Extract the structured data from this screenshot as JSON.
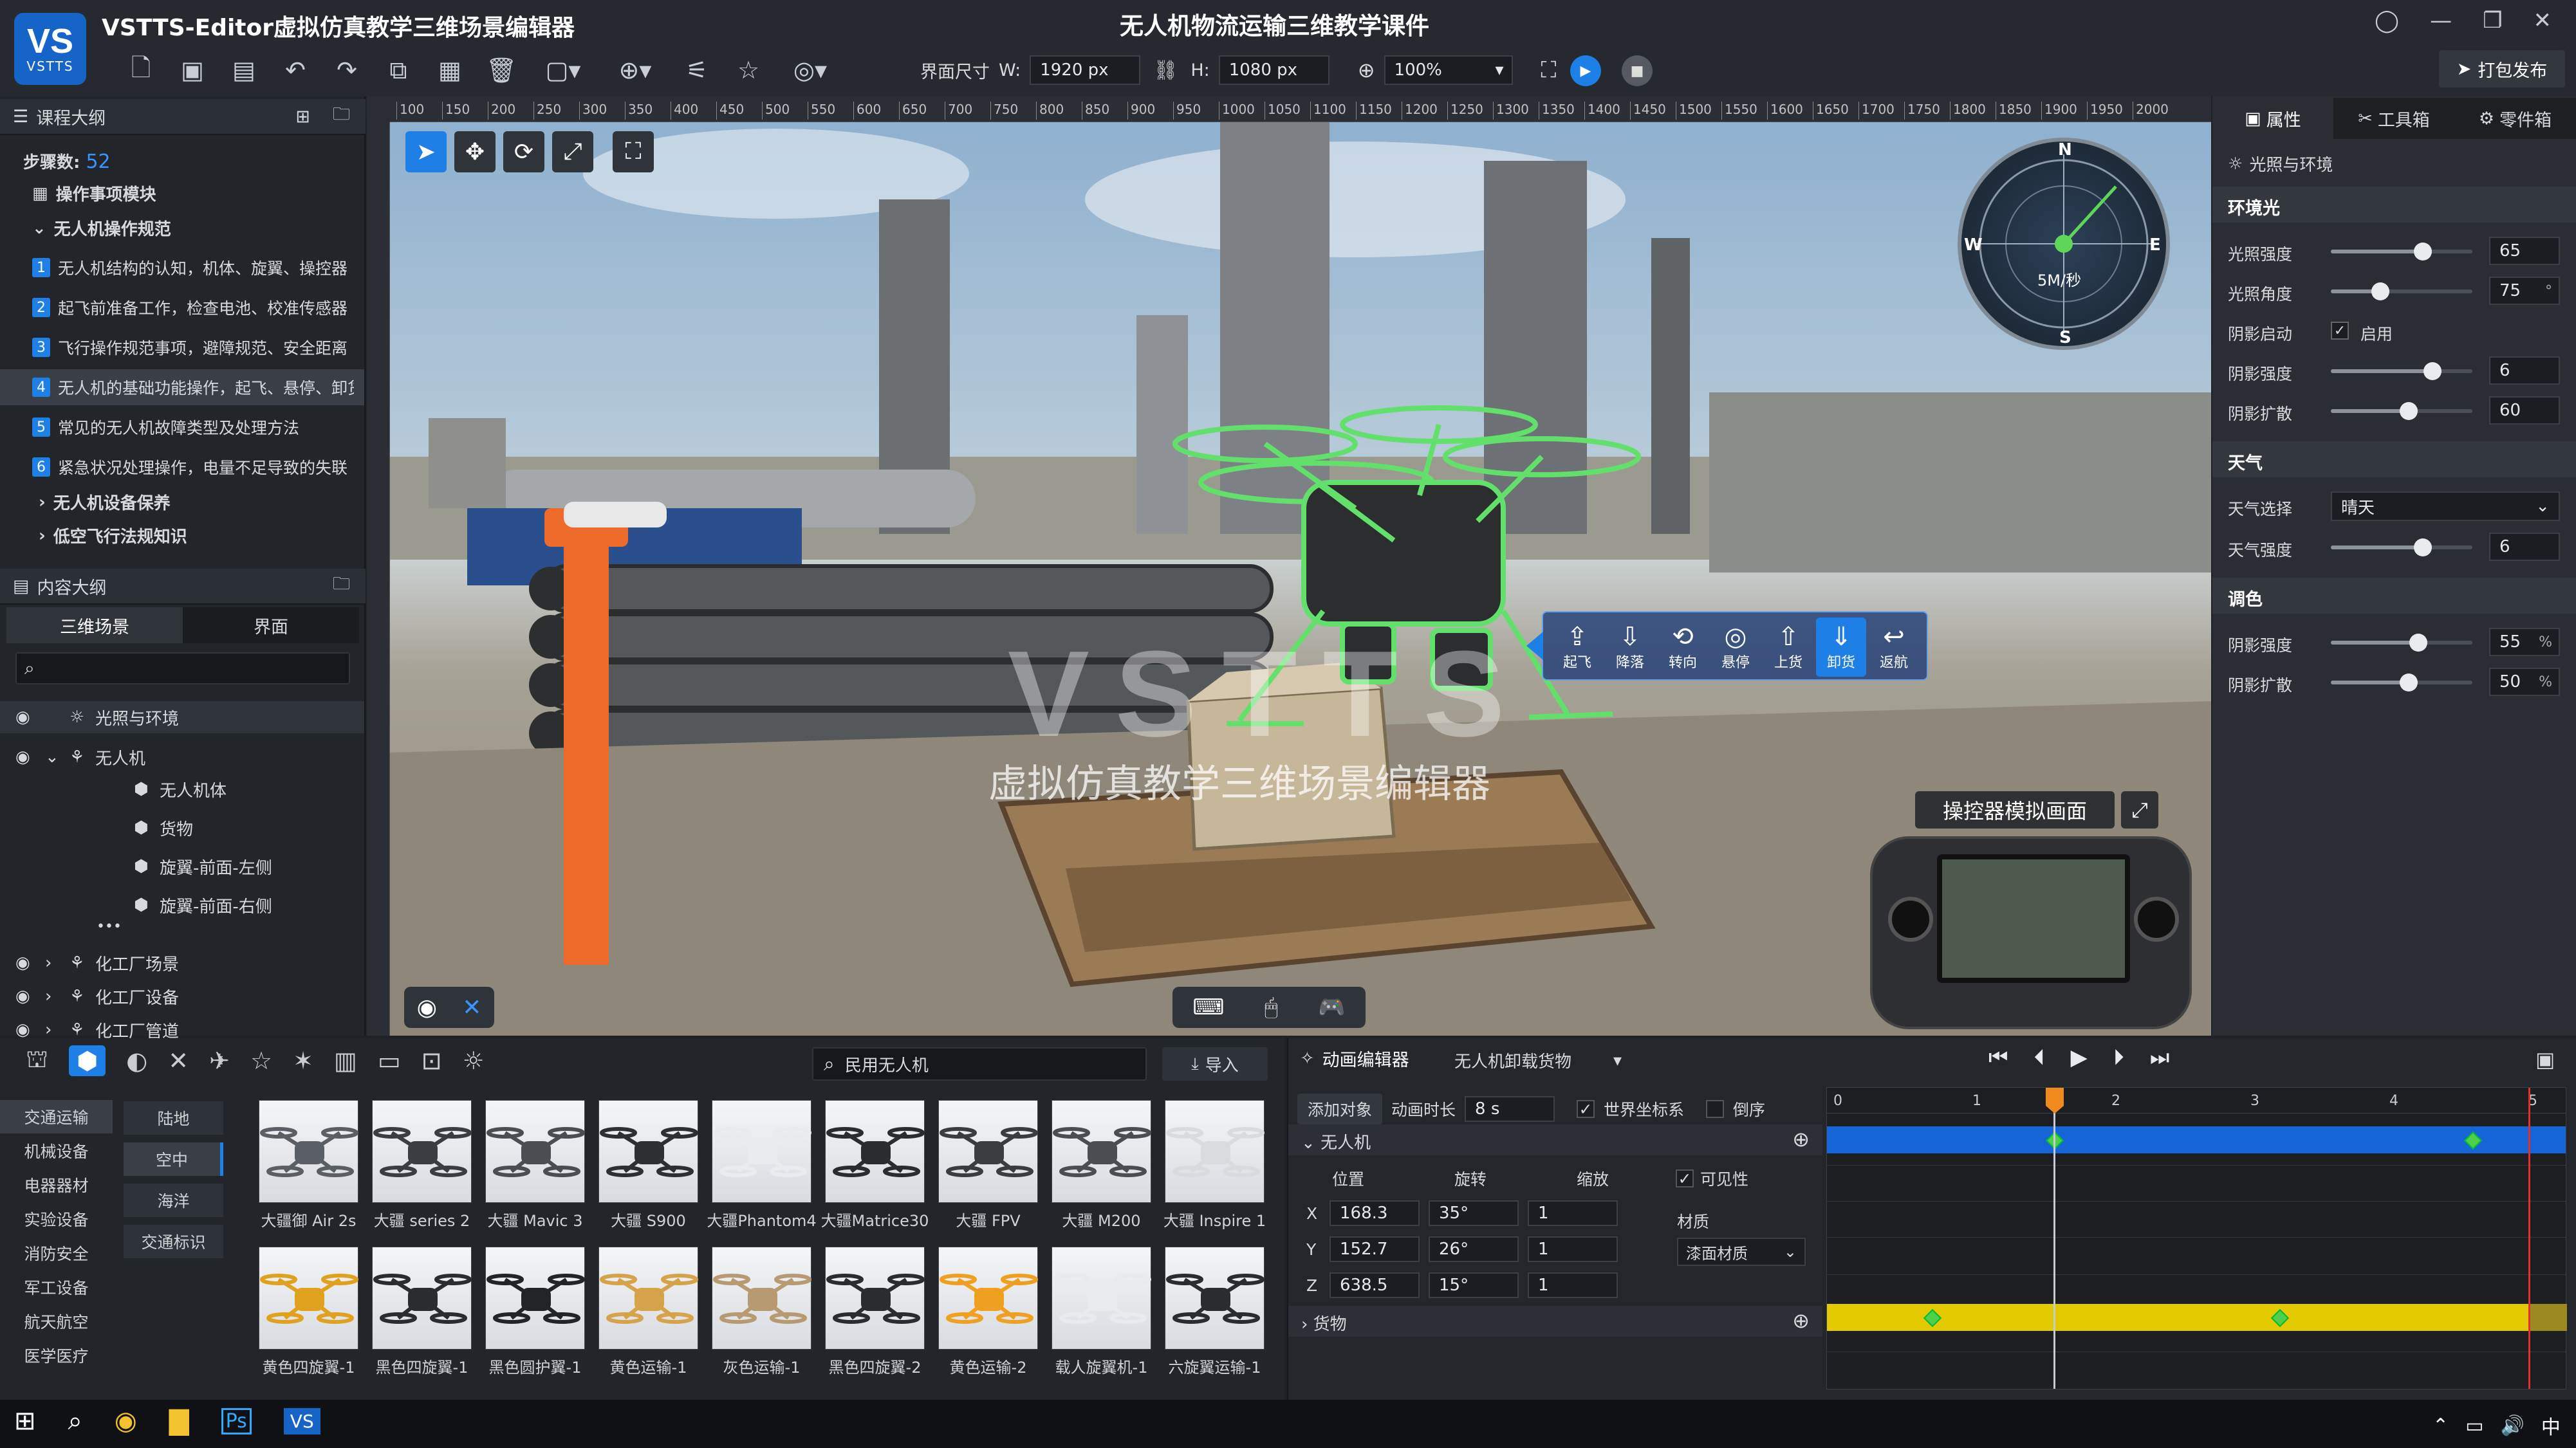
{
  "app": {
    "title": "VSTTS-Editor虚拟仿真教学三维场景编辑器",
    "doc_title": "无人机物流运输三维教学课件",
    "logo_text": "VSTTS",
    "publish_label": "打包发布"
  },
  "toolbar": {
    "size_label": "界面尺寸",
    "w_label": "W:",
    "w_value": "1920 px",
    "h_label": "H:",
    "h_value": "1080 px",
    "zoom": "100%"
  },
  "course": {
    "header": "课程大纲",
    "steps_label": "步骤数:",
    "steps_value": "52",
    "module": "操作事项模块",
    "group": "无人机操作规范",
    "items": [
      {
        "n": "1",
        "text": "无人机结构的认知，机体、旋翼、操控器"
      },
      {
        "n": "2",
        "text": "起飞前准备工作，检查电池、校准传感器"
      },
      {
        "n": "3",
        "text": "飞行操作规范事项，避障规范、安全距离"
      },
      {
        "n": "4",
        "text": "无人机的基础功能操作，起飞、悬停、卸货"
      },
      {
        "n": "5",
        "text": "常见的无人机故障类型及处理方法"
      },
      {
        "n": "6",
        "text": "紧急状况处理操作，电量不足导致的失联"
      }
    ],
    "collapsed": [
      "无人机设备保养",
      "低空飞行法规知识"
    ]
  },
  "content": {
    "header": "内容大纲",
    "tabs": [
      "三维场景",
      "界面"
    ],
    "tree": [
      {
        "label": "光照与环境",
        "level": 1
      },
      {
        "label": "无人机",
        "level": 1
      },
      {
        "label": "无人机体",
        "level": 2
      },
      {
        "label": "货物",
        "level": 2
      },
      {
        "label": "旋翼-前面-左侧",
        "level": 2
      },
      {
        "label": "旋翼-前面-右侧",
        "level": 2
      },
      {
        "label": "化工厂场景",
        "level": 1
      },
      {
        "label": "化工厂设备",
        "level": 1
      },
      {
        "label": "化工厂管道",
        "level": 1
      }
    ],
    "ellipsis": "•••"
  },
  "viewport": {
    "watermark_big": "VSTTS",
    "watermark_sub": "虚拟仿真教学三维场景编辑器",
    "ruler": [
      "100",
      "150",
      "200",
      "250",
      "300",
      "350",
      "400",
      "450",
      "500",
      "550",
      "600",
      "650",
      "700",
      "750",
      "800",
      "850",
      "900",
      "950",
      "1000",
      "1050",
      "1100",
      "1150",
      "1200",
      "1250",
      "1300",
      "1350",
      "1400",
      "1450",
      "1500",
      "1550",
      "1600",
      "1650",
      "1700",
      "1750",
      "1800",
      "1850",
      "1900",
      "1950",
      "2000"
    ],
    "compass": {
      "n": "N",
      "s": "S",
      "e": "E",
      "w": "W",
      "speed": "5M/秒"
    },
    "actions": [
      "起飞",
      "降落",
      "转向",
      "悬停",
      "上货",
      "卸货",
      "返航"
    ],
    "controller_label": "操控器模拟画面"
  },
  "props": {
    "tabs": [
      "属性",
      "工具箱",
      "零件箱"
    ],
    "section_title": "光照与环境",
    "ambient": {
      "title": "环境光",
      "light_intensity": {
        "label": "光照强度",
        "value": "65",
        "level": 0.65
      },
      "light_angle": {
        "label": "光照角度",
        "value": "75",
        "unit": "°",
        "level": 0.35
      },
      "shadow_enable": {
        "label": "阴影启动",
        "check": "启用"
      },
      "shadow_intensity": {
        "label": "阴影强度",
        "value": "6",
        "level": 0.72
      },
      "shadow_spread": {
        "label": "阴影扩散",
        "value": "60",
        "level": 0.55
      }
    },
    "weather": {
      "title": "天气",
      "select": {
        "label": "天气选择",
        "value": "晴天"
      },
      "intensity": {
        "label": "天气强度",
        "value": "6",
        "level": 0.65
      }
    },
    "color": {
      "title": "调色",
      "shadow_intensity": {
        "label": "阴影强度",
        "value": "55",
        "unit": "%",
        "level": 0.62
      },
      "shadow_spread": {
        "label": "阴影扩散",
        "value": "50",
        "unit": "%",
        "level": 0.55
      }
    }
  },
  "assets": {
    "search": "民用无人机",
    "import_label": "导入",
    "categories": [
      "交通运输",
      "机械设备",
      "电器器材",
      "实验设备",
      "消防安全",
      "军工设备",
      "航天航空",
      "医学医疗"
    ],
    "subcats": [
      "陆地",
      "空中",
      "海洋",
      "交通标识"
    ],
    "row1": [
      "大疆御 Air 2s",
      "大疆  series 2",
      "大疆 Mavic 3",
      "大疆 S900",
      "大疆Phantom4",
      "大疆Matrice30",
      "大疆 FPV",
      "大疆 M200",
      "大疆 Inspire 1"
    ],
    "row2": [
      "黄色四旋翼-1",
      "黑色四旋翼-1",
      "黑色圆护翼-1",
      "黄色运输-1",
      "灰色运输-1",
      "黑色四旋翼-2",
      "黄色运输-2",
      "载人旋翼机-1",
      "六旋翼运输-1"
    ]
  },
  "anim": {
    "title": "动画编辑器",
    "clip": "无人机卸载货物",
    "add_object": "添加对象",
    "duration_label": "动画时长",
    "duration_value": "8 s",
    "world_coord": "世界坐标系",
    "reverse": "倒序",
    "object1": "无人机",
    "object2": "货物",
    "col_pos": "位置",
    "col_rot": "旋转",
    "col_scale": "缩放",
    "visible": "可见性",
    "material_label": "材质",
    "material_value": "漆面材质",
    "x": {
      "label": "X",
      "pos": "168.3",
      "rot": "35°",
      "scale": "1"
    },
    "y": {
      "label": "Y",
      "pos": "152.7",
      "rot": "26°",
      "scale": "1"
    },
    "z": {
      "label": "Z",
      "pos": "638.5",
      "rot": "15°",
      "scale": "1"
    },
    "timeline_ticks": [
      "0",
      "1",
      "2",
      "3",
      "4",
      "5"
    ]
  },
  "colors": {
    "accent": "#1e7fe6",
    "blue_track": "#1565d8",
    "yellow_track": "#e3c900",
    "playhead": "#f08a1c"
  }
}
